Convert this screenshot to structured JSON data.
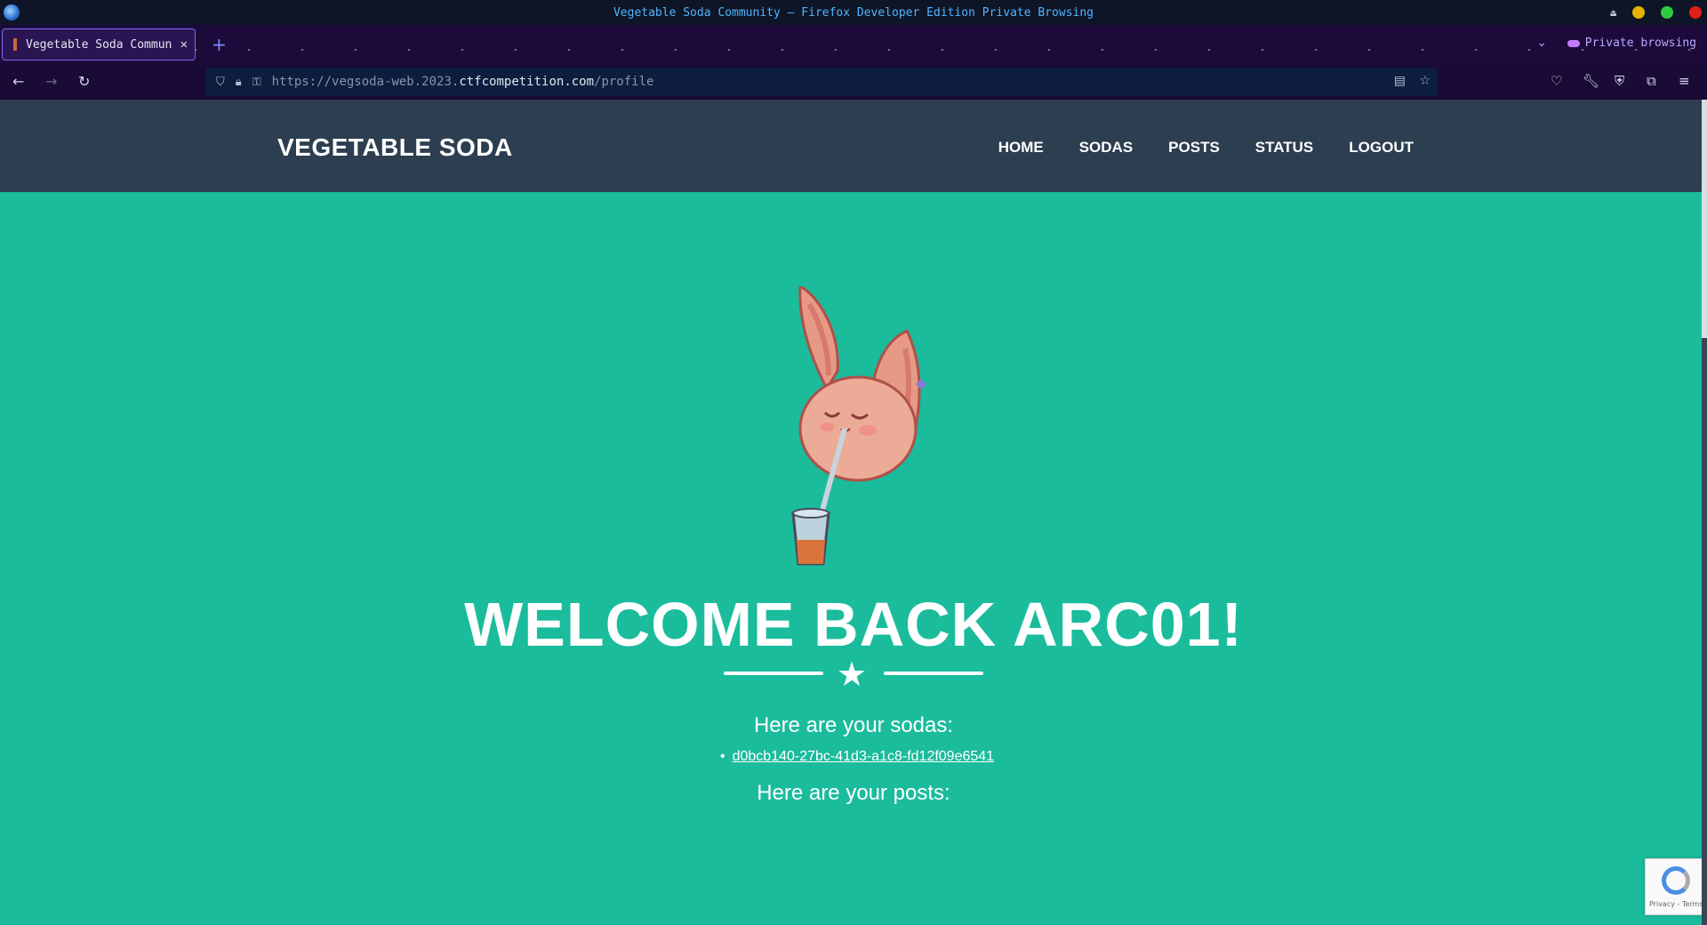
{
  "browser": {
    "window_title": "Vegetable Soda Community — Firefox Developer Edition Private Browsing",
    "tab_title": "Vegetable Soda Commun",
    "url_prefix": "https://vegsoda-web.2023.",
    "url_domain": "ctfcompetition.com",
    "url_path": "/profile",
    "private_label": "Private browsing"
  },
  "site": {
    "brand": "VEGETABLE SODA",
    "nav": [
      "HOME",
      "SODAS",
      "POSTS",
      "STATUS",
      "LOGOUT"
    ]
  },
  "profile": {
    "welcome": "WELCOME BACK ARC01!",
    "sodas_heading": "Here are your sodas:",
    "sodas": [
      "d0bcb140-27bc-41d3-a1c8-fd12f09e6541"
    ],
    "posts_heading": "Here are your posts:"
  },
  "recaptcha": {
    "terms": "Privacy - Terms"
  },
  "colors": {
    "page_bg": "#1abc9c",
    "nav_bg": "#2c3e50"
  }
}
